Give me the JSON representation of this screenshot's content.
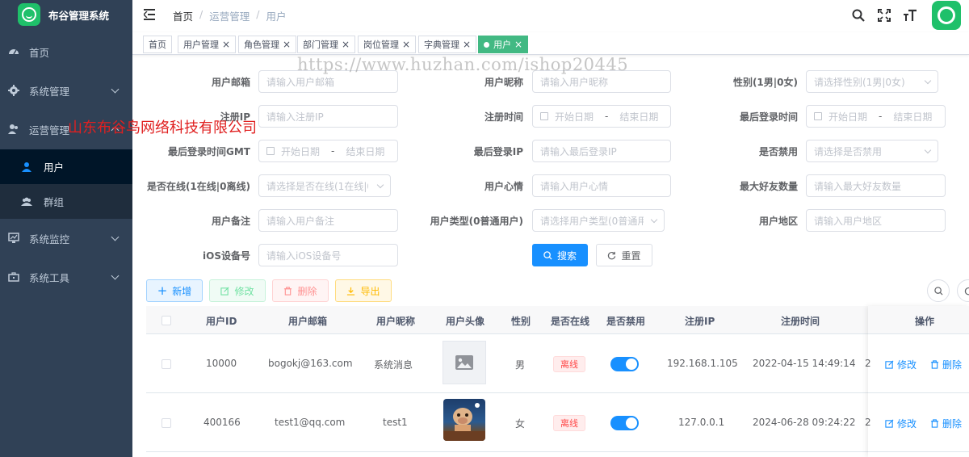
{
  "app": {
    "title": "布谷管理系统",
    "overlay_company": "山东布谷鸟网络科技有限公司",
    "watermark": "https://www.huzhan.com/ishop20445"
  },
  "sidebar": {
    "items": [
      {
        "label": "首页",
        "icon": "dashboard-icon"
      },
      {
        "label": "系统管理",
        "icon": "gear-icon"
      },
      {
        "label": "运营管理",
        "icon": "user-group-icon"
      },
      {
        "label": "用户",
        "icon": "user-icon",
        "active": true
      },
      {
        "label": "群组",
        "icon": "peoples-icon"
      },
      {
        "label": "系统监控",
        "icon": "monitor-icon"
      },
      {
        "label": "系统工具",
        "icon": "toolbox-icon"
      }
    ]
  },
  "navbar": {
    "breadcrumb": [
      "首页",
      "运营管理",
      "用户"
    ],
    "separator": "/"
  },
  "tags": [
    {
      "label": "首页",
      "closable": false
    },
    {
      "label": "用户管理",
      "closable": true
    },
    {
      "label": "角色管理",
      "closable": true
    },
    {
      "label": "部门管理",
      "closable": true
    },
    {
      "label": "岗位管理",
      "closable": true
    },
    {
      "label": "字典管理",
      "closable": true
    },
    {
      "label": "用户",
      "closable": true,
      "active": true
    }
  ],
  "form": {
    "email": {
      "label": "用户邮箱",
      "placeholder": "请输入用户邮箱"
    },
    "nickname": {
      "label": "用户昵称",
      "placeholder": "请输入用户昵称"
    },
    "gender": {
      "label": "性别(1男|0女)",
      "placeholder": "请选择性别(1男|0女)"
    },
    "reg_ip": {
      "label": "注册IP",
      "placeholder": "请输入注册IP"
    },
    "reg_time": {
      "label": "注册时间",
      "start": "开始日期",
      "end": "结束日期",
      "dash": "-"
    },
    "last_login_time": {
      "label": "最后登录时间",
      "start": "开始日期",
      "end": "结束日期",
      "dash": "-"
    },
    "last_login_gmt": {
      "label": "最后登录时间GMT",
      "start": "开始日期",
      "end": "结束日期",
      "dash": "-"
    },
    "last_login_ip": {
      "label": "最后登录IP",
      "placeholder": "请输入最后登录IP"
    },
    "disabled": {
      "label": "是否禁用",
      "placeholder": "请选择是否禁用"
    },
    "online": {
      "label": "是否在线(1在线|0离线)",
      "placeholder": "请选择是否在线(1在线|0离线)"
    },
    "mood": {
      "label": "用户心情",
      "placeholder": "请输入用户心情"
    },
    "max_friends": {
      "label": "最大好友数量",
      "placeholder": "请输入最大好友数量"
    },
    "remark": {
      "label": "用户备注",
      "placeholder": "请输入用户备注"
    },
    "user_type": {
      "label": "用户类型(0普通用户)",
      "placeholder": "请选择用户类型(0普通用户)"
    },
    "region": {
      "label": "用户地区",
      "placeholder": "请输入用户地区"
    },
    "ios_device": {
      "label": "iOS设备号",
      "placeholder": "请输入iOS设备号"
    },
    "search_btn": "搜索",
    "reset_btn": "重置"
  },
  "toolbar": {
    "add": "新增",
    "edit": "修改",
    "delete": "删除",
    "export": "导出"
  },
  "table": {
    "columns": [
      "用户ID",
      "用户邮箱",
      "用户昵称",
      "用户头像",
      "性别",
      "是否在线",
      "是否禁用",
      "注册IP",
      "注册时间",
      "操作"
    ],
    "rows": [
      {
        "id": "10000",
        "email": "bogokj@163.com",
        "nickname": "系统消息",
        "avatar": "placeholder",
        "gender": "男",
        "online": "离线",
        "disabled": true,
        "ip": "192.168.1.105",
        "reg_time": "2022-04-15 14:49:14",
        "cut": "2"
      },
      {
        "id": "400166",
        "email": "test1@qq.com",
        "nickname": "test1",
        "avatar": "photo",
        "gender": "女",
        "online": "离线",
        "disabled": true,
        "ip": "127.0.0.1",
        "reg_time": "2024-06-28 09:24:22",
        "cut": "2"
      }
    ],
    "op_edit": "修改",
    "op_delete": "删除"
  },
  "colors": {
    "sidebar_bg": "#304156",
    "primary": "#1890ff",
    "brand_green": "#1fc06a",
    "tag_active": "#42b983"
  }
}
